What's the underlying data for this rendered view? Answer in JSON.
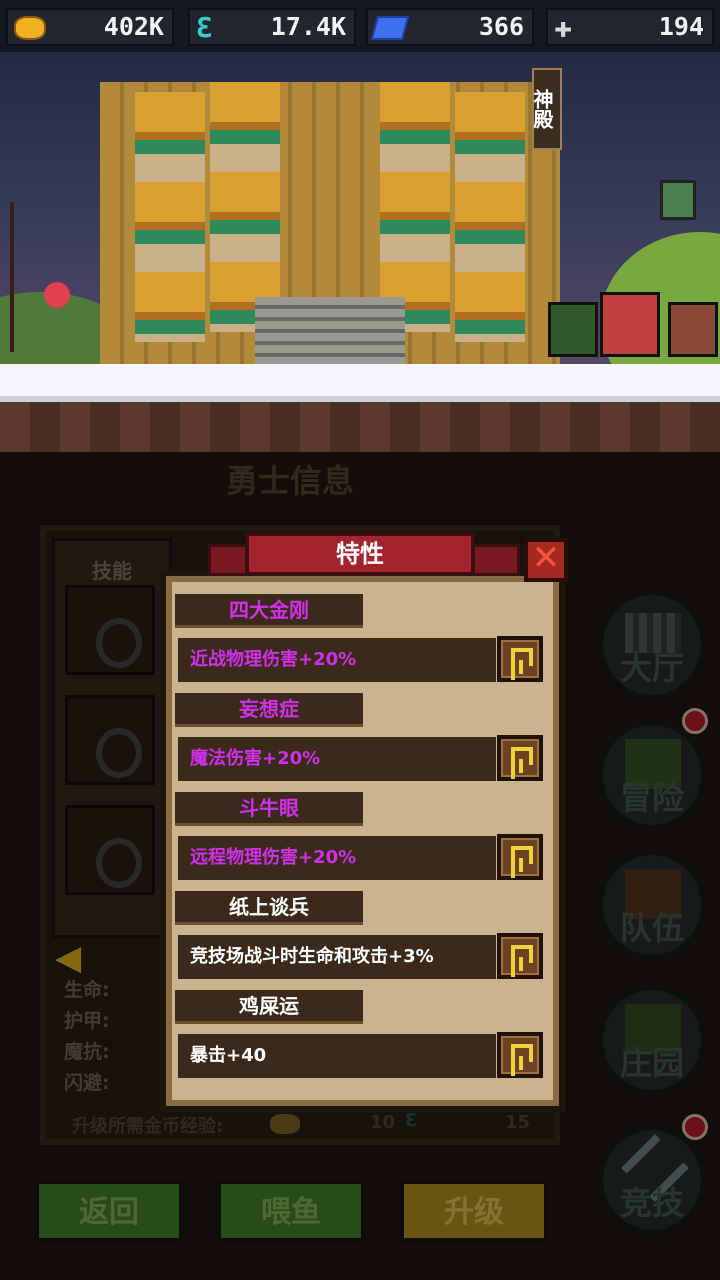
{
  "resources": [
    {
      "icon": "gold-coin-icon",
      "value": "402K"
    },
    {
      "icon": "energy-icon",
      "value": "17.4K"
    },
    {
      "icon": "diamond-icon",
      "value": "366"
    },
    {
      "icon": "cross-icon",
      "value": "194"
    }
  ],
  "scene": {
    "location_sign": "神殿"
  },
  "hero_panel": {
    "title": "勇士信息",
    "skills_label": "技能",
    "stats": [
      "生命:",
      "护甲:",
      "魔抗:",
      "闪避:"
    ],
    "upgrade_requirement": {
      "label": "升级所需金币经验:",
      "coin_value": "10",
      "energy_value": "15"
    }
  },
  "side_menu": [
    {
      "label": "大厅",
      "icon": "hall-icon",
      "badge": false
    },
    {
      "label": "冒险",
      "icon": "adventure-icon",
      "badge": true
    },
    {
      "label": "队伍",
      "icon": "team-icon",
      "badge": false
    },
    {
      "label": "庄园",
      "icon": "manor-icon",
      "badge": false
    },
    {
      "label": "竞技",
      "icon": "arena-icon",
      "badge": true
    }
  ],
  "bottom_buttons": {
    "back": "返回",
    "feed": "喂鱼",
    "upgrade": "升级"
  },
  "traits_modal": {
    "title": "特性",
    "traits": [
      {
        "name": "四大金刚",
        "desc": "近战物理伤害+20%",
        "color": "#d030e8"
      },
      {
        "name": "妄想症",
        "desc": "魔法伤害+20%",
        "color": "#d030e8"
      },
      {
        "name": "斗牛眼",
        "desc": "远程物理伤害+20%",
        "color": "#d030e8"
      },
      {
        "name": "纸上谈兵",
        "desc": "竞技场战斗时生命和攻击+3%",
        "color": "#ffffff"
      },
      {
        "name": "鸡屎运",
        "desc": "暴击+40",
        "color": "#ffffff"
      }
    ]
  }
}
